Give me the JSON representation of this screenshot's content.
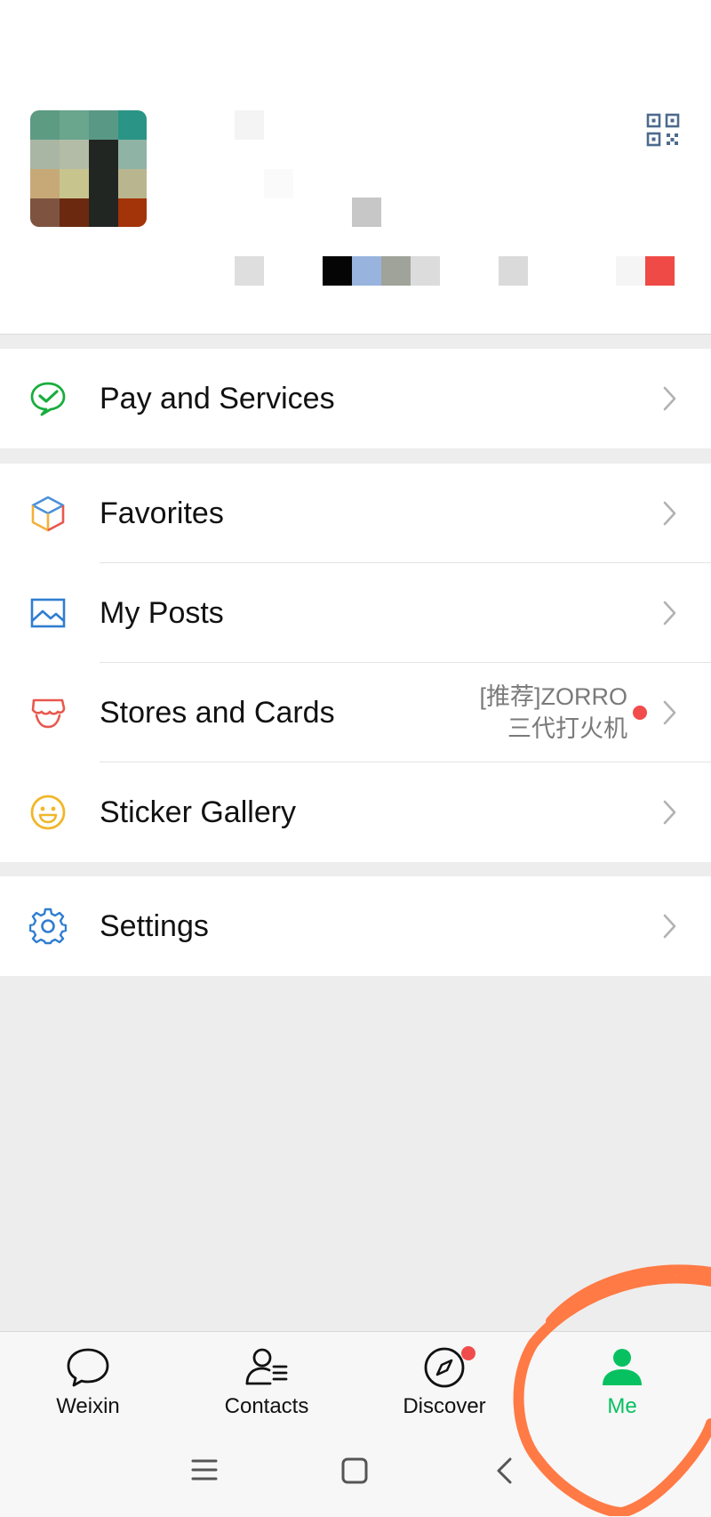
{
  "menu": {
    "pay": {
      "label": "Pay and Services"
    },
    "favorites": {
      "label": "Favorites"
    },
    "my_posts": {
      "label": "My Posts"
    },
    "stores": {
      "label": "Stores and Cards",
      "promo_line1": "[推荐]ZORRO",
      "promo_line2": "三代打火机"
    },
    "stickers": {
      "label": "Sticker Gallery"
    },
    "settings": {
      "label": "Settings"
    }
  },
  "tabs": [
    {
      "label": "Weixin",
      "icon": "chat-bubble-icon"
    },
    {
      "label": "Contacts",
      "icon": "contacts-icon"
    },
    {
      "label": "Discover",
      "icon": "compass-icon"
    },
    {
      "label": "Me",
      "icon": "person-icon"
    }
  ],
  "colors": {
    "accent": "#07c160",
    "badge": "#f14c4c",
    "annotation": "#ff7a45"
  }
}
